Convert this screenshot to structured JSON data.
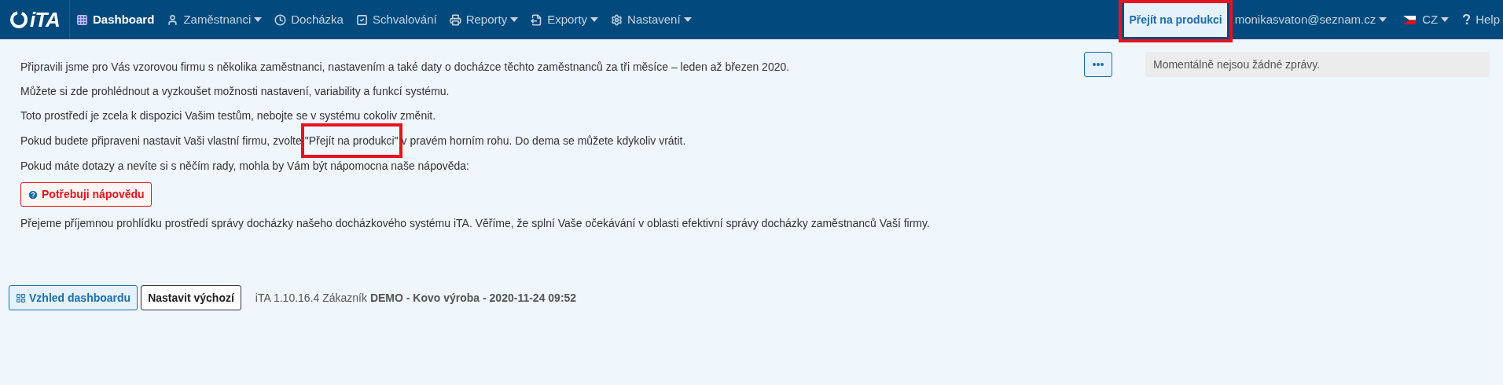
{
  "navbar": {
    "logo_text": "iTA",
    "items": [
      {
        "kind": "grid",
        "label": "Dashboard",
        "dropdown": false,
        "selected": true
      },
      {
        "kind": "user",
        "label": "Zaměstnanci",
        "dropdown": true,
        "selected": false
      },
      {
        "kind": "clock",
        "label": "Docházka",
        "dropdown": false,
        "selected": false
      },
      {
        "kind": "check",
        "label": "Schvalování",
        "dropdown": false,
        "selected": false
      },
      {
        "kind": "printer",
        "label": "Reporty",
        "dropdown": true,
        "selected": false
      },
      {
        "kind": "export",
        "label": "Exporty",
        "dropdown": true,
        "selected": false
      },
      {
        "kind": "gear",
        "label": "Nastavení",
        "dropdown": true,
        "selected": false
      }
    ],
    "production_link": {
      "label": "Přejít na produkci",
      "highlighted": true
    },
    "user": {
      "label": "monikasvaton@seznam.cz",
      "dropdown": true
    },
    "language": {
      "label": "CZ",
      "dropdown": true
    },
    "help": {
      "label": "Help"
    }
  },
  "intro": [
    {
      "text": "Připravili jsme pro Vás vzorovou firmu s několika zaměstnanci, nastavením a také daty o docházce těchto zaměstnanců za tři měsíce – leden až březen 2020."
    },
    {
      "text": "Můžete si zde prohlédnout a vyzkoušet možnosti nastavení, variability a funkcí systému."
    },
    {
      "text": "Toto prostředí je zcela k dispozici Vašim testům, nebojte se v systému cokoliv změnit."
    },
    {
      "before": "Pokud budete připraveni nastavit Vaši vlastní firmu, zvolte",
      "quote": "\"Přejít na produkci\"",
      "after": "v pravém horním rohu. Do dema se můžete kdykoliv vrátit.",
      "highlighted": true
    },
    {
      "text": "Pokud máte dotazy a nevíte si s něčím rady, mohla by Vám být nápomocna naše nápověda:"
    }
  ],
  "help_button": {
    "label": "Potřebuji nápovědu"
  },
  "closing": "Přejeme příjemnou prohlídku prostředí správy docházky našeho docházkového systému iTA. Věříme, že splní Vaše očekávání v oblasti efektivní správy docházky zaměstnanců Vaší firmy.",
  "messages": {
    "text": "Momentálně nejsou žádné zprávy."
  },
  "footer": {
    "layout_button": "Vzhled dashboardu",
    "default_button": "Nastavit výchozí",
    "version": "iTA 1.10.16.4 Zákazník **DEMO - Kovo výroba - 2020-11-24 09:52**"
  }
}
